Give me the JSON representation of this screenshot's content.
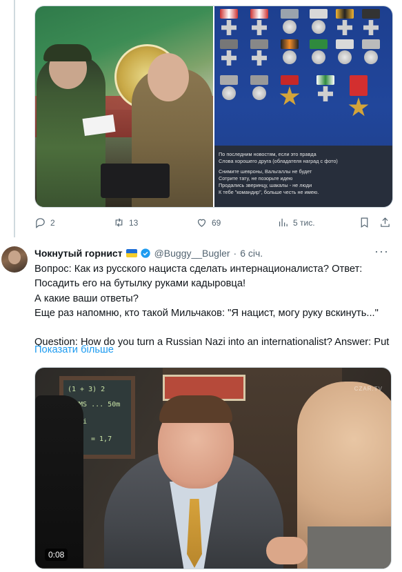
{
  "tweet1": {
    "caption_lines": [
      "По последним новостям, если это правда",
      "Слова хорошего друга (обладателя наград с фото)",
      "",
      "Снимите шевроны, Вальгаллы не будет",
      "Сотрите тату, не позорьте идею",
      "Продались зверинцу, шакалы - не люди",
      "К тебе \"командир\", больше честь не имею."
    ],
    "actions": {
      "replies": "2",
      "reposts": "13",
      "likes": "69",
      "views": "5 тис."
    }
  },
  "tweet2": {
    "name": "Чокнутый горнист",
    "handle": "@Buggy__Bugler",
    "time": "6 січ.",
    "text_lines": [
      "Вопрос: Как из русского нациста сделать интернационалиста? Ответ:",
      "Посадить его на бутылку руками кадыровца!",
      "А какие ваши ответы?",
      "Еще раз напомню, кто такой Мильчаков: \"Я нацист, могу руку вскинуть...\"",
      "",
      "Question: How do you turn a Russian Nazi into an internationalist? Answer: Put"
    ],
    "show_more": "Показати більше",
    "video": {
      "duration": "0:08",
      "watermark": "CZAR.TV"
    }
  },
  "colors": {
    "link": "#1d9bf0",
    "secondary_text": "#536471",
    "verified": "#1d9bf0"
  },
  "icons": [
    "reply-icon",
    "repost-icon",
    "like-icon",
    "views-icon",
    "bookmark-icon",
    "share-icon",
    "verified-icon",
    "more-icon"
  ]
}
